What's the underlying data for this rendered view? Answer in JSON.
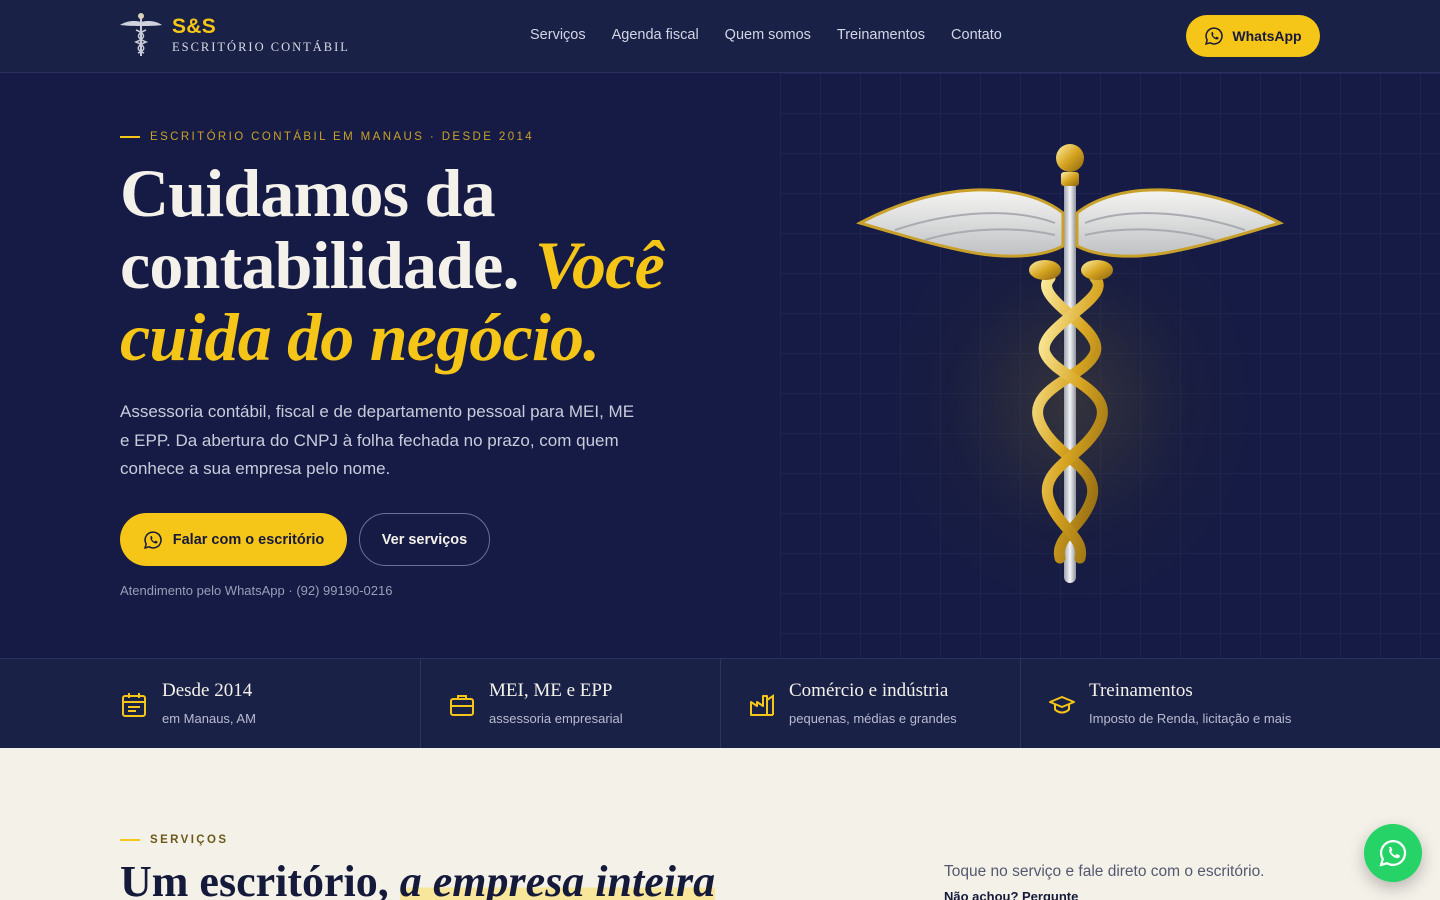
{
  "nav": {
    "brand": "S&S",
    "brand_sub": "ESCRITÓRIO CONTÁBIL",
    "menu": [
      "Serviços",
      "Agenda fiscal",
      "Quem somos",
      "Treinamentos",
      "Contato"
    ],
    "cta": "WhatsApp"
  },
  "hero": {
    "eyebrow": "ESCRITÓRIO CONTÁBIL EM MANAUS · DESDE 2014",
    "headline_plain": "Cuidamos da contabilidade. ",
    "headline_accent": "Você cuida do negócio.",
    "lead": "Assessoria contábil, fiscal e de departamento pessoal para MEI, ME e EPP. Da abertura do CNPJ à folha fechada no prazo, com quem conhece a sua empresa pelo nome.",
    "primary_cta": "Falar com o escritório",
    "secondary_cta": "Ver serviços",
    "note": "Atendimento pelo WhatsApp · (92) 99190-0216"
  },
  "stats": [
    {
      "icon": "calendar-icon",
      "title": "Desde 2014",
      "sub": "em Manaus, AM"
    },
    {
      "icon": "briefcase-icon",
      "title": "MEI, ME e EPP",
      "sub": "assessoria empresarial"
    },
    {
      "icon": "factory-icon",
      "title": "Comércio e indústria",
      "sub": "pequenas, médias e grandes"
    },
    {
      "icon": "graduation-cap-icon",
      "title": "Treinamentos",
      "sub": "Imposto de Renda, licitação e mais"
    }
  ],
  "services": {
    "eyebrow": "SERVIÇOS",
    "title_plain": "Um escritório, ",
    "title_accent": "a empresa inteira",
    "note": "Toque no serviço e fale direto com o escritório.",
    "link": "Não achou? Pergunte"
  },
  "colors": {
    "accent": "#f5c518",
    "navy": "#151b44",
    "cream": "#f4f1e9",
    "whatsapp": "#25d366"
  }
}
